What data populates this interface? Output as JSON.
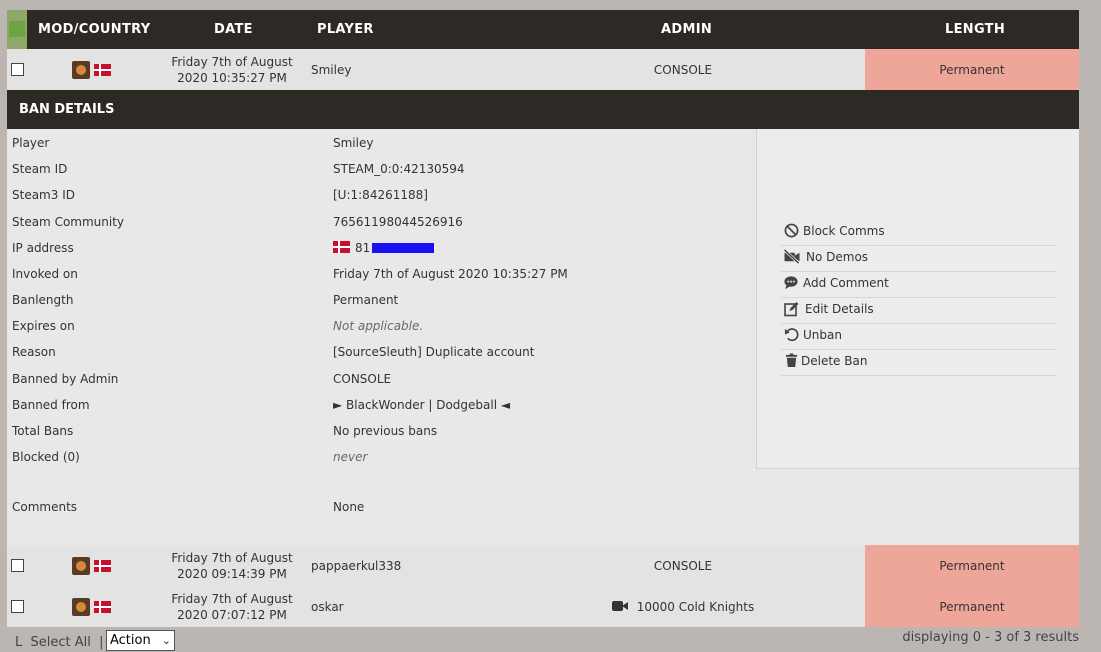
{
  "header": {
    "mod_country": "MOD/COUNTRY",
    "date": "DATE",
    "player": "PLAYER",
    "admin": "ADMIN",
    "length": "LENGTH"
  },
  "bans": [
    {
      "date_line1": "Friday 7th of August",
      "date_line2": "2020 10:35:27 PM",
      "player": "Smiley",
      "admin": "CONSOLE",
      "length": "Permanent"
    },
    {
      "date_line1": "Friday 7th of August",
      "date_line2": "2020 09:14:39 PM",
      "player": "pappaerkul338",
      "admin": "CONSOLE",
      "length": "Permanent"
    },
    {
      "date_line1": "Friday 7th of August",
      "date_line2": "2020 07:07:12 PM",
      "player": "oskar",
      "admin": "10000 Cold Knights",
      "length": "Permanent"
    }
  ],
  "details": {
    "title": "BAN DETAILS",
    "labels": {
      "player": "Player",
      "steam_id": "Steam ID",
      "steam3_id": "Steam3 ID",
      "steam_community": "Steam Community",
      "ip": "IP address",
      "invoked": "Invoked on",
      "banlength": "Banlength",
      "expires": "Expires on",
      "reason": "Reason",
      "banned_by": "Banned by Admin",
      "banned_from": "Banned from",
      "total_bans": "Total Bans",
      "blocked": "Blocked (0)",
      "comments": "Comments"
    },
    "values": {
      "player": "Smiley",
      "steam_id": "STEAM_0:0:42130594",
      "steam3_id": "[U:1:84261188]",
      "steam_community": "76561198044526916",
      "ip_prefix": "81",
      "invoked": "Friday 7th of August 2020 10:35:27 PM",
      "banlength": "Permanent",
      "expires": "Not applicable.",
      "reason": "[SourceSleuth] Duplicate account",
      "banned_by": "CONSOLE",
      "banned_from": "► BlackWonder | Dodgeball ◄",
      "total_bans": "No previous bans",
      "blocked": "never",
      "comments": "None"
    },
    "actions": [
      {
        "label": "Block Comms",
        "icon": "block-icon"
      },
      {
        "label": "No Demos",
        "icon": "no-video-icon"
      },
      {
        "label": "Add Comment",
        "icon": "comment-icon"
      },
      {
        "label": "Edit Details",
        "icon": "edit-icon"
      },
      {
        "label": "Unban",
        "icon": "undo-icon"
      },
      {
        "label": "Delete Ban",
        "icon": "trash-icon"
      }
    ]
  },
  "footer": {
    "select_all": "Select All",
    "action_select": "Action",
    "result_count": "displaying 0 - 3 of 3 results"
  }
}
